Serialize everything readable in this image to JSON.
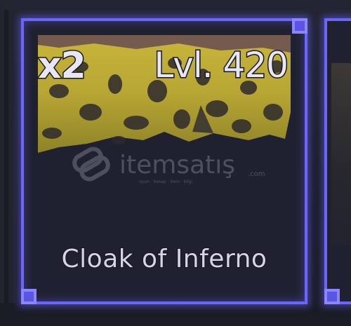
{
  "slot": {
    "quantity": "x2",
    "level": "Lvl. 420",
    "item_name": "Cloak of Inferno",
    "item_icon": "leopard-cloak-icon",
    "border_color": "#6a65ff"
  },
  "watermark": {
    "brand": "itemsatış",
    "tagline": "oyun · hesap · item · bilgi",
    "suffix": ".com",
    "icon": "itemsatis-logo-icon"
  },
  "adjacent_slot": {
    "icon": "partial-item-icon"
  }
}
